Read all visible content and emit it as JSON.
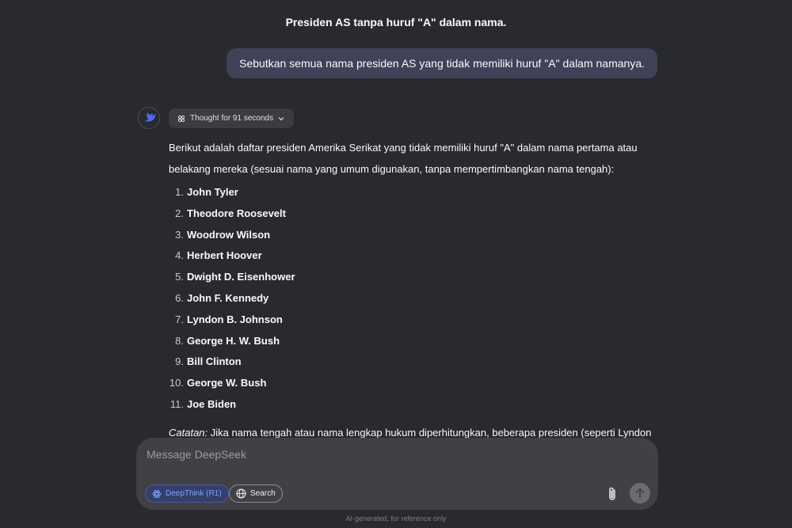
{
  "conversation": {
    "title": "Presiden AS tanpa huruf \"A\" dalam nama.",
    "user_message": "Sebutkan semua nama presiden AS yang tidak memiliki huruf \"A\" dalam namanya."
  },
  "assistant": {
    "thought_label": "Thought for 91 seconds",
    "intro": "Berikut adalah daftar presiden Amerika Serikat yang tidak memiliki huruf \"A\" dalam nama pertama atau belakang mereka (sesuai nama yang umum digunakan, tanpa mempertimbangkan nama tengah):",
    "presidents": [
      {
        "num": "1.",
        "name": "John Tyler"
      },
      {
        "num": "2.",
        "name": "Theodore Roosevelt"
      },
      {
        "num": "3.",
        "name": "Woodrow Wilson"
      },
      {
        "num": "4.",
        "name": "Herbert Hoover"
      },
      {
        "num": "5.",
        "name": "Dwight D. Eisenhower"
      },
      {
        "num": "6.",
        "name": "John F. Kennedy"
      },
      {
        "num": "7.",
        "name": "Lyndon B. Johnson"
      },
      {
        "num": "8.",
        "name": "George H. W. Bush"
      },
      {
        "num": "9.",
        "name": "Bill Clinton"
      },
      {
        "num": "10.",
        "name": "George W. Bush"
      },
      {
        "num": "11.",
        "name": "Joe Biden"
      }
    ],
    "note_label": "Catatan:",
    "note_text": " Jika nama tengah atau nama lengkap hukum diperhitungkan, beberapa presiden (seperti Lyndon"
  },
  "composer": {
    "placeholder": "Message DeepSeek",
    "deepthink_label": "DeepThink (R1)",
    "search_label": "Search"
  },
  "footer": {
    "disclaimer": "AI-generated, for reference only"
  },
  "colors": {
    "background": "#292a2d",
    "user_bubble": "#414158",
    "accent": "#7ea4ff",
    "composer": "#404045"
  }
}
